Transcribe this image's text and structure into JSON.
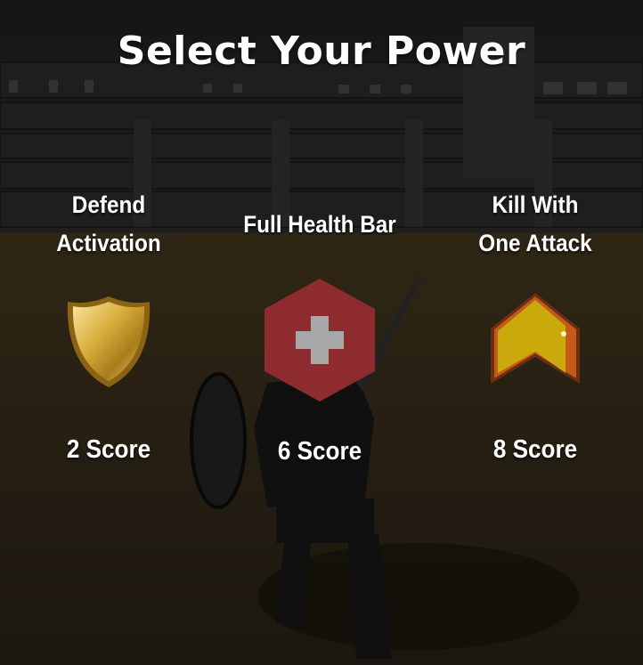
{
  "screen": {
    "title": "Select Your Power"
  },
  "powers": [
    {
      "name_line1": "Defend",
      "name_line2": "Activation",
      "cost": "2 Score",
      "icon": "gold-shield-icon",
      "color": "#d9ae3c"
    },
    {
      "name_line1": "Full Health Bar",
      "cost": "6 Score",
      "icon": "health-cross-icon",
      "color": "#8e2b2f"
    },
    {
      "name_line1": "Kill With",
      "name_line2": "One Attack",
      "cost": "8 Score",
      "icon": "chevron-badge-icon",
      "color": "#c9a90c"
    }
  ]
}
